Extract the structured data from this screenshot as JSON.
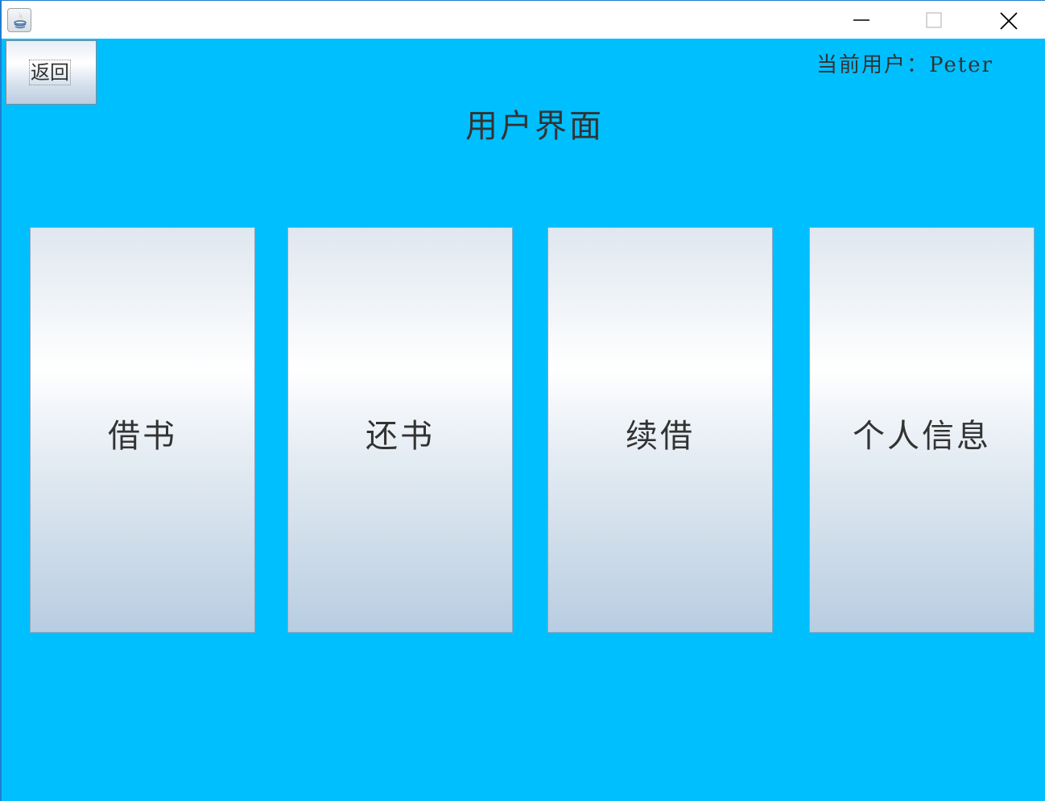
{
  "window": {
    "controls": [
      "minimize",
      "maximize",
      "close"
    ]
  },
  "toolbar": {
    "back_label": "返回"
  },
  "header": {
    "current_user": "当前用户：Peter",
    "title": "用户界面"
  },
  "menu": {
    "items": [
      {
        "label": "借书"
      },
      {
        "label": "还书"
      },
      {
        "label": "续借"
      },
      {
        "label": "个人信息"
      }
    ]
  },
  "colors": {
    "background": "#00bfff",
    "button_text": "#333333"
  },
  "icons": {
    "app": "java-coffee-icon",
    "minimize": "minimize-icon",
    "maximize": "maximize-icon",
    "close": "close-icon"
  }
}
